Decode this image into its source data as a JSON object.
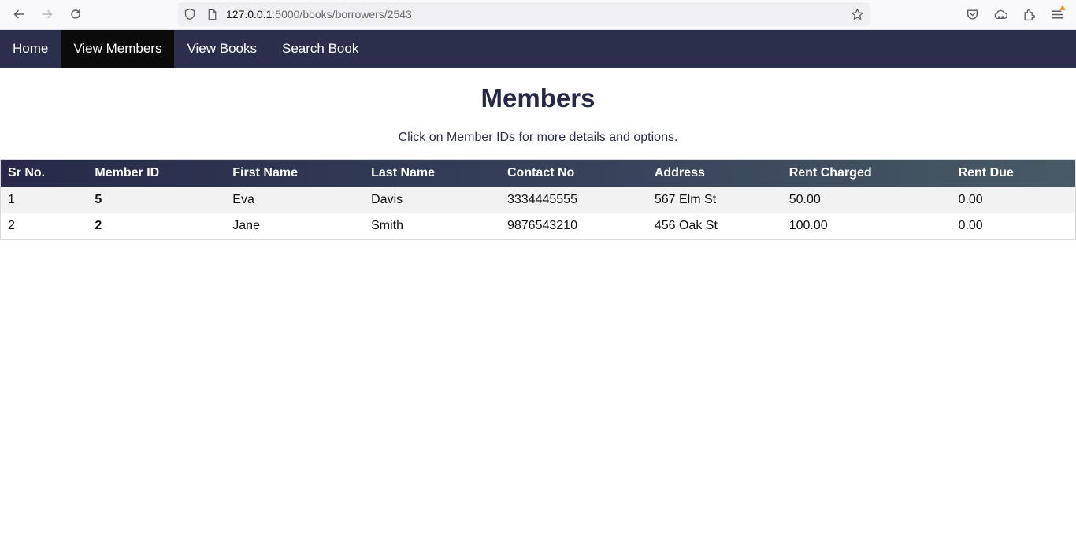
{
  "browser": {
    "url_host": "127.0.0.1",
    "url_rest": ":5000/books/borrowers/2543",
    "icons": [
      "back-icon",
      "forward-icon",
      "reload-icon",
      "shield-icon",
      "page-icon",
      "star-icon",
      "pocket-icon",
      "extensions-cloud-icon",
      "extensions-icon",
      "menu-icon"
    ],
    "badge_color": "#e8a33b"
  },
  "nav": {
    "items": [
      {
        "label": "Home"
      },
      {
        "label": "View Members"
      },
      {
        "label": "View Books"
      },
      {
        "label": "Search Book"
      }
    ],
    "active_index": 1,
    "bg_color": "#2a2f4b",
    "active_color": "#0b0b0b"
  },
  "page": {
    "title": "Members",
    "subtitle": "Click on Member IDs for more details and options."
  },
  "table": {
    "headers": [
      "Sr No.",
      "Member ID",
      "First Name",
      "Last Name",
      "Contact No",
      "Address",
      "Rent Charged",
      "Rent Due"
    ],
    "rows": [
      [
        "1",
        "5",
        "Eva",
        "Davis",
        "3334445555",
        "567 Elm St",
        "50.00",
        "0.00"
      ],
      [
        "2",
        "2",
        "Jane",
        "Smith",
        "9876543210",
        "456 Oak St",
        "100.00",
        "0.00"
      ]
    ]
  }
}
